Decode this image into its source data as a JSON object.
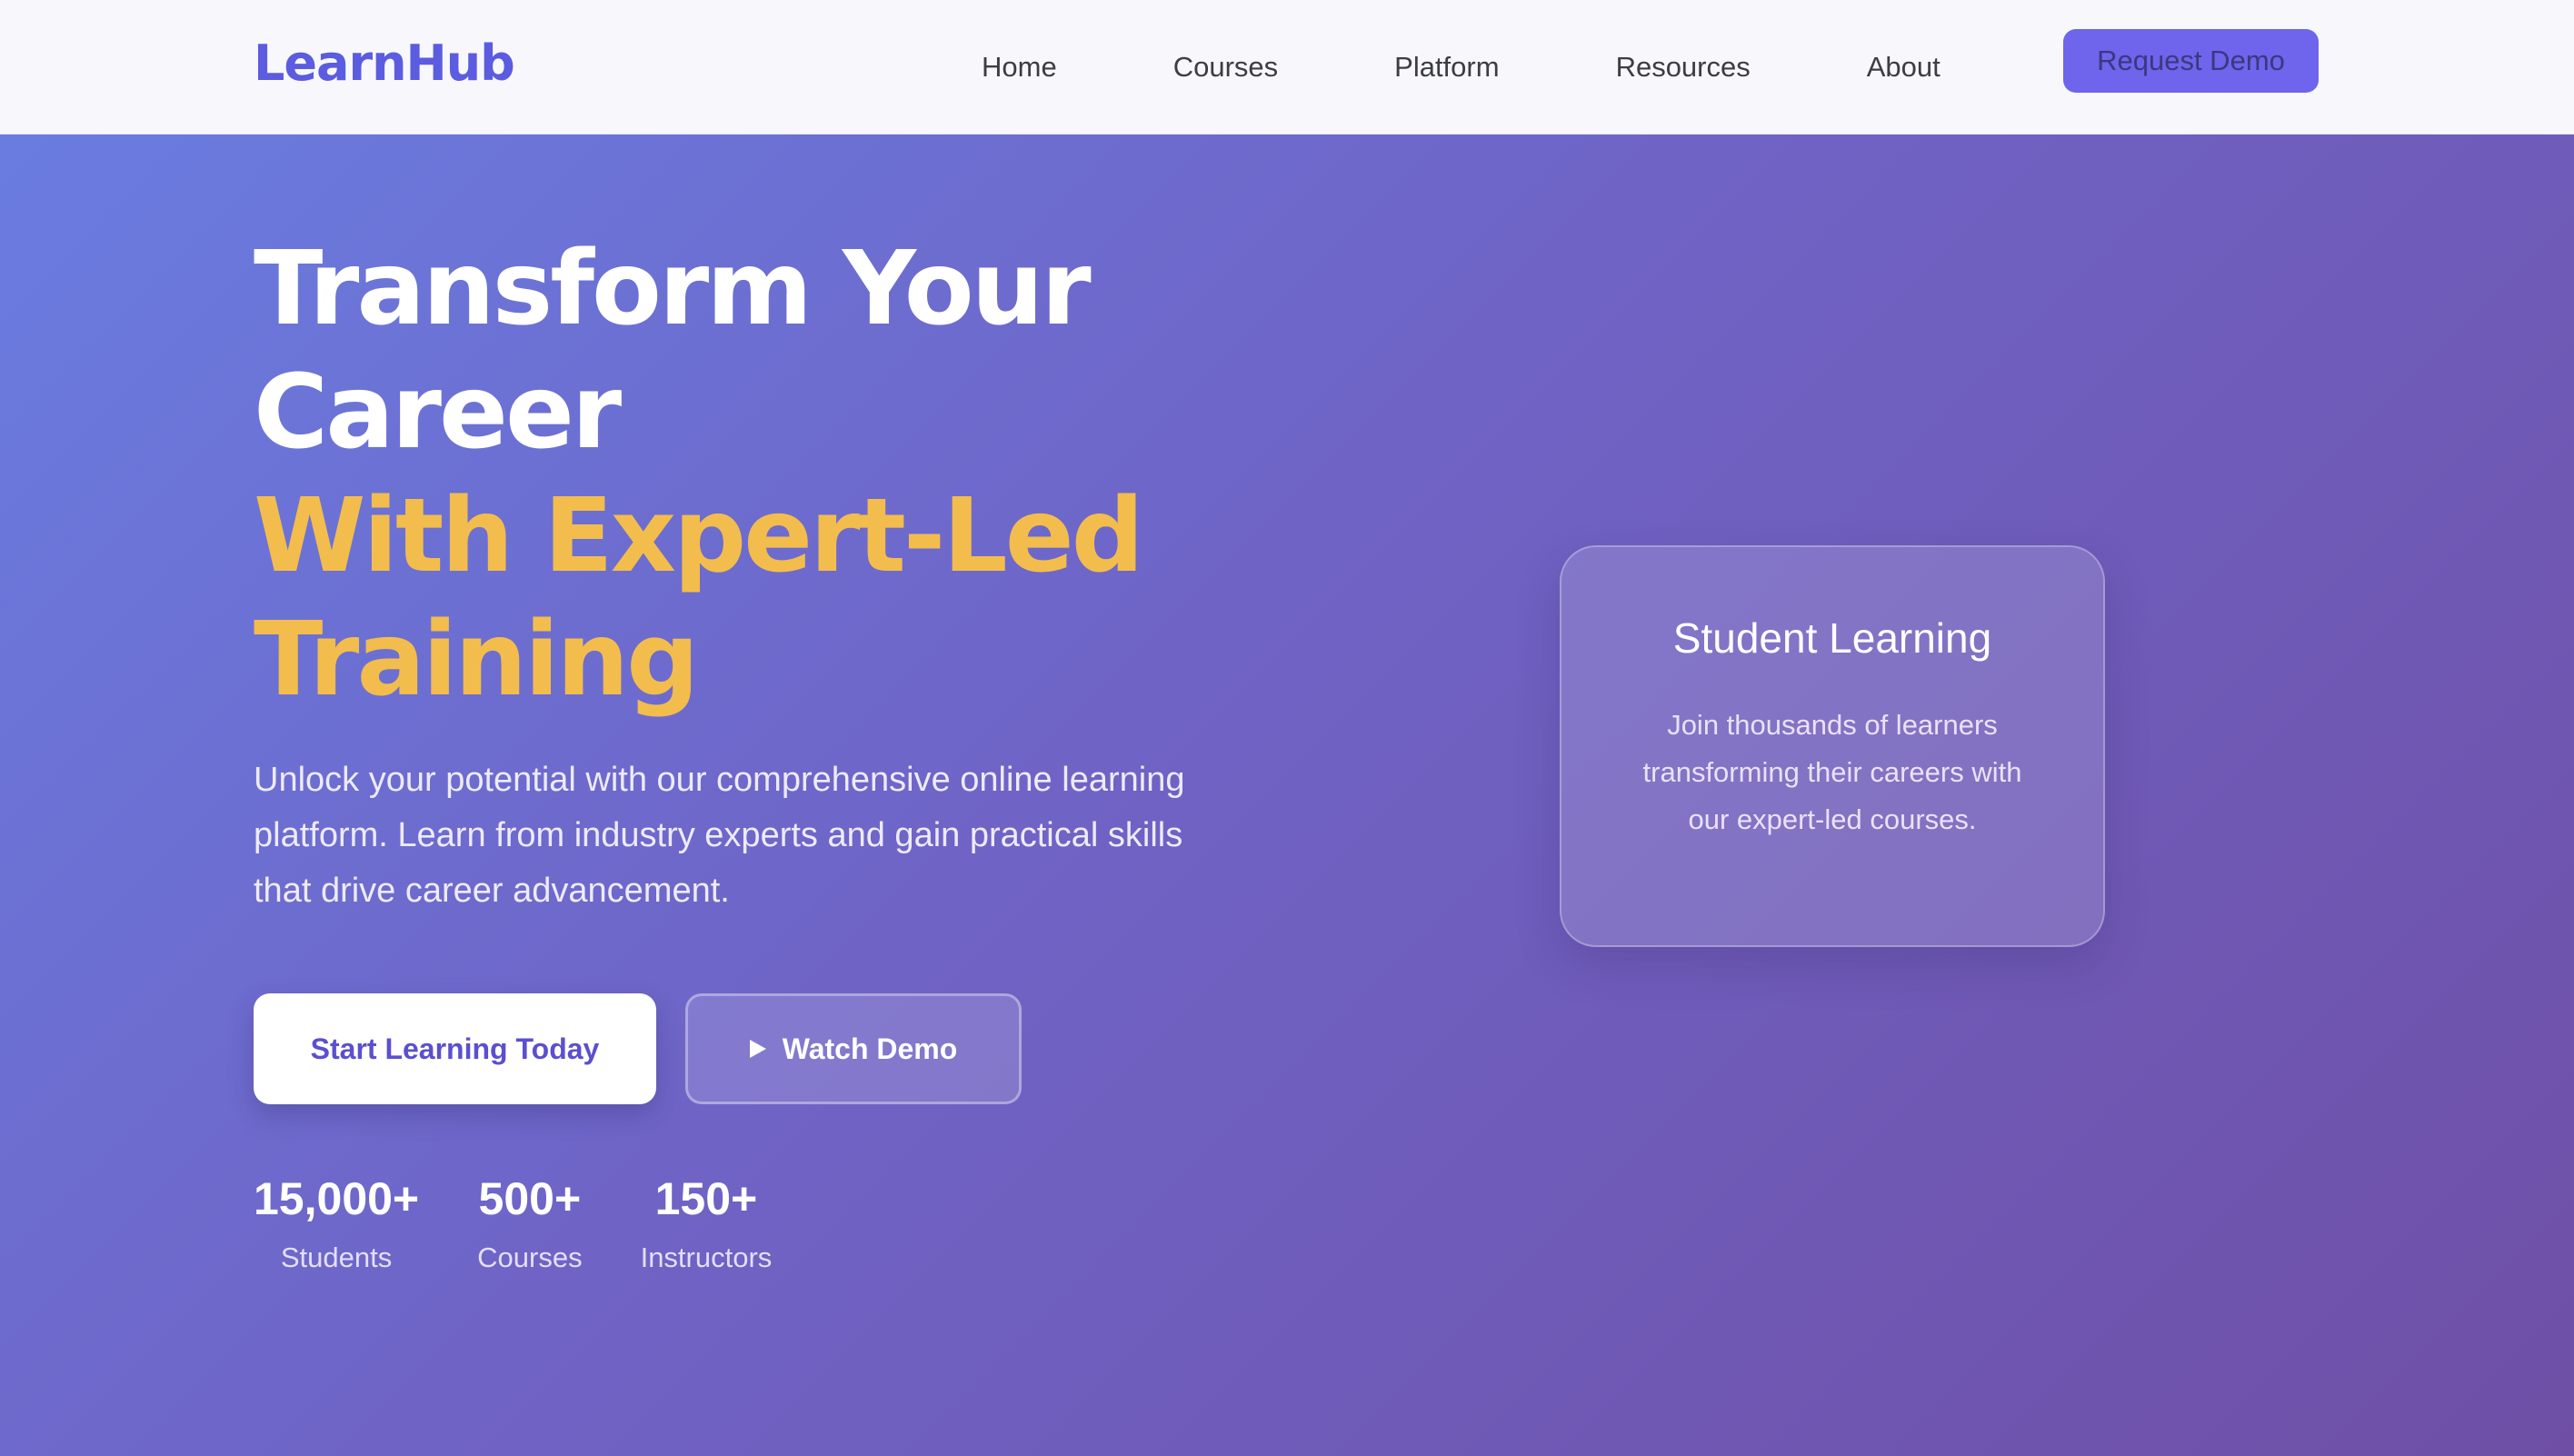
{
  "brand": {
    "name": "LearnHub",
    "color": "#5b5ce0"
  },
  "nav": {
    "items": [
      "Home",
      "Courses",
      "Platform",
      "Resources",
      "About"
    ],
    "cta_label": "Request Demo"
  },
  "hero": {
    "title_line1": "Transform Your",
    "title_line2": "Career",
    "title_highlight_line1": "With Expert-Led",
    "title_highlight_line2": "Training",
    "description": "Unlock your potential with our comprehensive online learning platform. Learn from industry experts and gain practical skills that drive career advancement.",
    "primary_button": "Start Learning Today",
    "secondary_button": "Watch Demo",
    "secondary_icon": "play-icon",
    "stats": [
      {
        "value": "15,000+",
        "label": "Students"
      },
      {
        "value": "500+",
        "label": "Courses"
      },
      {
        "value": "150+",
        "label": "Instructors"
      }
    ]
  },
  "card": {
    "title": "Student Learning",
    "text": "Join thousands of learners transforming their careers with our expert-led courses."
  },
  "colors": {
    "accent": "#f2bd4c",
    "gradient_start": "#6a7ce0",
    "gradient_end": "#6f4fa6",
    "cta_bg": "#6f64ec"
  }
}
